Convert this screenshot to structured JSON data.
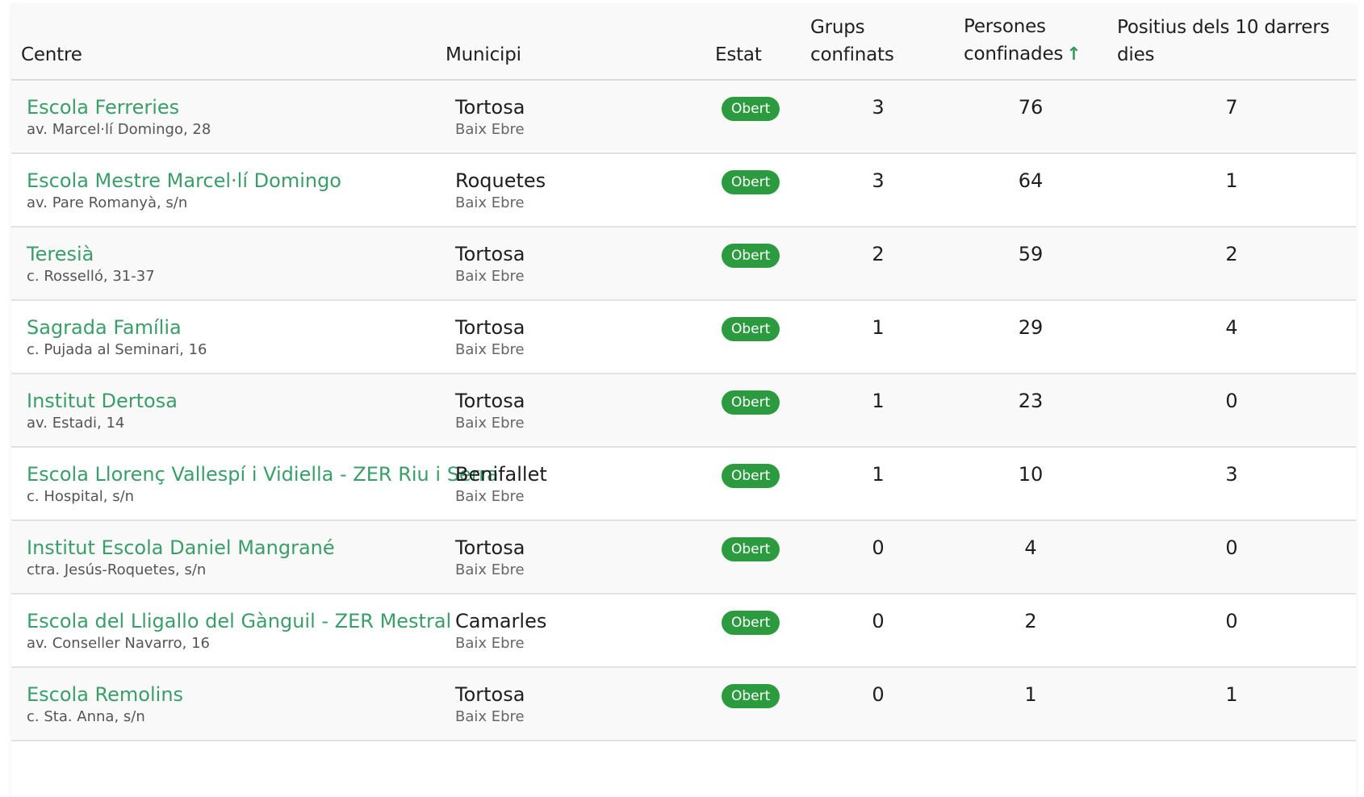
{
  "table": {
    "headers": {
      "centre": "Centre",
      "municipi": "Municipi",
      "estat": "Estat",
      "grups": "Grups confinats",
      "persones": "Persones confinades",
      "positius": "Positius dels 10 darrers dies"
    },
    "sort": {
      "column": "persones",
      "icon": "arrow-up-icon",
      "color": "#2e9b57"
    },
    "rows": [
      {
        "name": "Escola Ferreries",
        "address": "av. Marcel·lí Domingo, 28",
        "municipi": "Tortosa",
        "comarca": "Baix Ebre",
        "estat": "Obert",
        "grups": "3",
        "persones": "76",
        "positius": "7"
      },
      {
        "name": "Escola Mestre Marcel·lí Domingo",
        "address": "av. Pare Romanyà, s/n",
        "municipi": "Roquetes",
        "comarca": "Baix Ebre",
        "estat": "Obert",
        "grups": "3",
        "persones": "64",
        "positius": "1"
      },
      {
        "name": "Teresià",
        "address": "c. Rosselló, 31-37",
        "municipi": "Tortosa",
        "comarca": "Baix Ebre",
        "estat": "Obert",
        "grups": "2",
        "persones": "59",
        "positius": "2"
      },
      {
        "name": "Sagrada Família",
        "address": "c. Pujada al Seminari, 16",
        "municipi": "Tortosa",
        "comarca": "Baix Ebre",
        "estat": "Obert",
        "grups": "1",
        "persones": "29",
        "positius": "4"
      },
      {
        "name": "Institut Dertosa",
        "address": "av. Estadi, 14",
        "municipi": "Tortosa",
        "comarca": "Baix Ebre",
        "estat": "Obert",
        "grups": "1",
        "persones": "23",
        "positius": "0"
      },
      {
        "name": "Escola Llorenç Vallespí i Vidiella - ZER Riu i Serra",
        "address": "c. Hospital, s/n",
        "municipi": "Benifallet",
        "comarca": "Baix Ebre",
        "estat": "Obert",
        "grups": "1",
        "persones": "10",
        "positius": "3"
      },
      {
        "name": "Institut Escola Daniel Mangrané",
        "address": "ctra. Jesús-Roquetes, s/n",
        "municipi": "Tortosa",
        "comarca": "Baix Ebre",
        "estat": "Obert",
        "grups": "0",
        "persones": "4",
        "positius": "0"
      },
      {
        "name": "Escola del Lligallo del Gànguil - ZER Mestral",
        "address": "av. Conseller Navarro, 16",
        "municipi": "Camarles",
        "comarca": "Baix Ebre",
        "estat": "Obert",
        "grups": "0",
        "persones": "2",
        "positius": "0"
      },
      {
        "name": "Escola Remolins",
        "address": "c. Sta. Anna, s/n",
        "municipi": "Tortosa",
        "comarca": "Baix Ebre",
        "estat": "Obert",
        "grups": "0",
        "persones": "1",
        "positius": "1"
      }
    ]
  },
  "colors": {
    "link": "#3a9e69",
    "badge": "#2c9a3e"
  }
}
